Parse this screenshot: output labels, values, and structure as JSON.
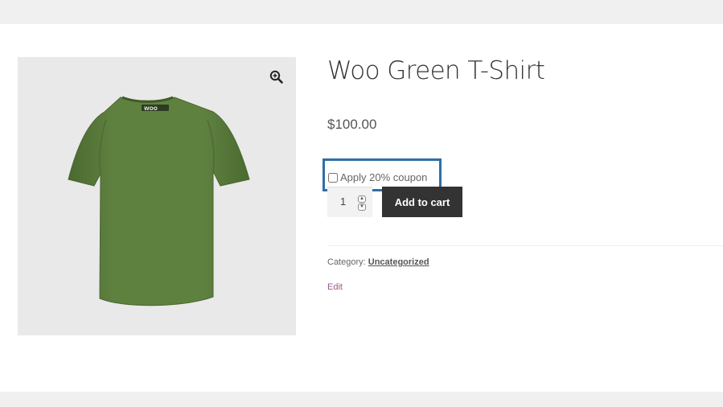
{
  "product": {
    "title": "Woo Green T-Shirt",
    "price": "$100.00",
    "shirt_color": "#5c7d3d",
    "logo_text": "WOO"
  },
  "coupon": {
    "label": "Apply 20% coupon",
    "checked": false,
    "highlight_color": "#2f6ea7"
  },
  "quantity": {
    "value": "1"
  },
  "cart": {
    "button_label": "Add to cart",
    "button_bg": "#333333"
  },
  "meta": {
    "category_label": "Category:",
    "category_value": "Uncategorized",
    "edit_label": "Edit",
    "edit_color": "#96588a"
  },
  "icons": {
    "zoom": "zoom-in-magnifier-icon"
  }
}
